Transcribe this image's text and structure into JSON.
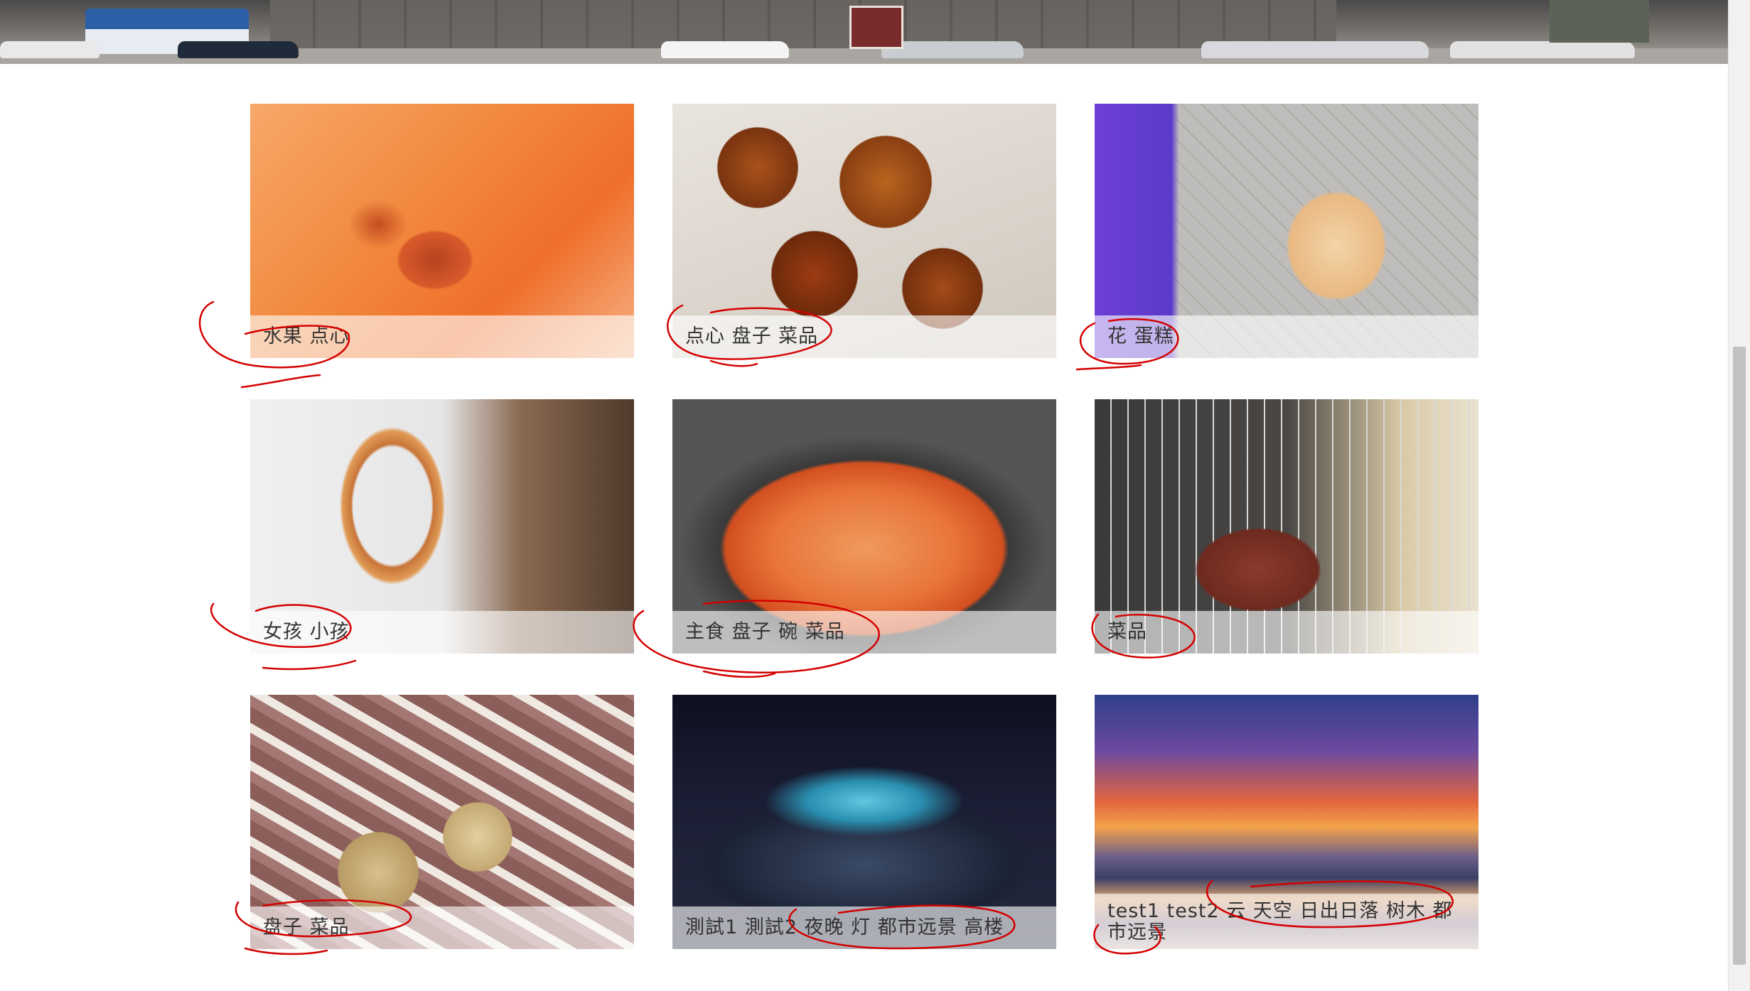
{
  "gallery": {
    "items": [
      {
        "caption": "水果 点心"
      },
      {
        "caption": "点心 盘子 菜品"
      },
      {
        "caption": "花 蛋糕"
      },
      {
        "caption": "女孩 小孩"
      },
      {
        "caption": "主食 盘子 碗 菜品"
      },
      {
        "caption": "菜品"
      },
      {
        "caption": "盘子 菜品"
      },
      {
        "caption": "測試1 測試2 夜晚 灯 都市远景 高楼"
      },
      {
        "caption": "test1 test2 云 天空 日出日落 树木 都市远景"
      }
    ]
  },
  "colors": {
    "caption_text": "#333333",
    "caption_bg": "rgba(255,255,255,0.62)",
    "annotation": "#d40000"
  }
}
